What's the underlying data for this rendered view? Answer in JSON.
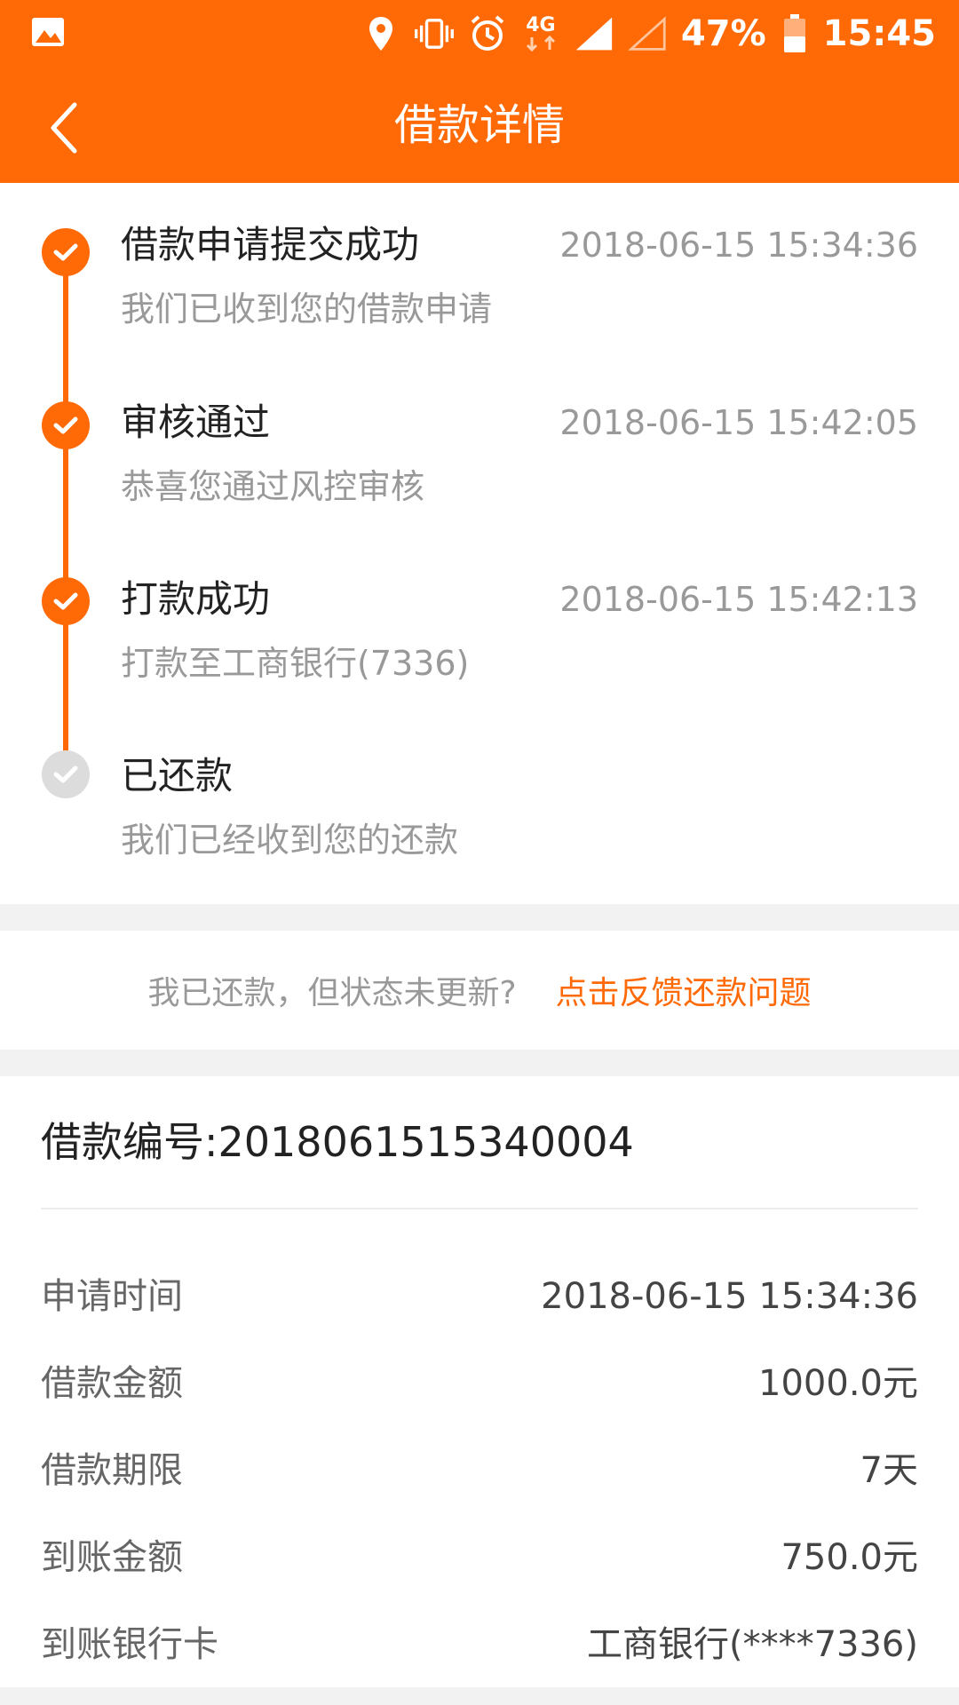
{
  "statusbar": {
    "network": "4G",
    "battery_percent": "47%",
    "time": "15:45",
    "icons": [
      "image-icon",
      "location-icon",
      "vibrate-icon",
      "alarm-icon",
      "data-arrows-icon",
      "signal-full-icon",
      "signal-empty-icon",
      "battery-icon"
    ]
  },
  "header": {
    "title": "借款详情",
    "back_icon": "chevron-left-icon"
  },
  "timeline": {
    "steps": [
      {
        "title": "借款申请提交成功",
        "time": "2018-06-15 15:34:36",
        "desc": "我们已收到您的借款申请",
        "done": true
      },
      {
        "title": "审核通过",
        "time": "2018-06-15 15:42:05",
        "desc": "恭喜您通过风控审核",
        "done": true
      },
      {
        "title": "打款成功",
        "time": "2018-06-15 15:42:13",
        "desc": "打款至工商银行(7336)",
        "done": true
      },
      {
        "title": "已还款",
        "time": "",
        "desc": "我们已经收到您的还款",
        "done": false
      }
    ]
  },
  "feedback": {
    "text": "我已还款，但状态未更新?",
    "link": "点击反馈还款问题"
  },
  "details": {
    "loan_no": "借款编号:2018061515340004",
    "rows": [
      {
        "label": "申请时间",
        "value": "2018-06-15 15:34:36"
      },
      {
        "label": "借款金额",
        "value": "1000.0元"
      },
      {
        "label": "借款期限",
        "value": "7天"
      },
      {
        "label": "到账金额",
        "value": "750.0元"
      },
      {
        "label": "到账银行卡",
        "value": "工商银行(****7336)"
      }
    ]
  },
  "colors": {
    "accent": "#ff6a07",
    "inactive": "#dcdcdc",
    "muted_text": "#999999"
  }
}
